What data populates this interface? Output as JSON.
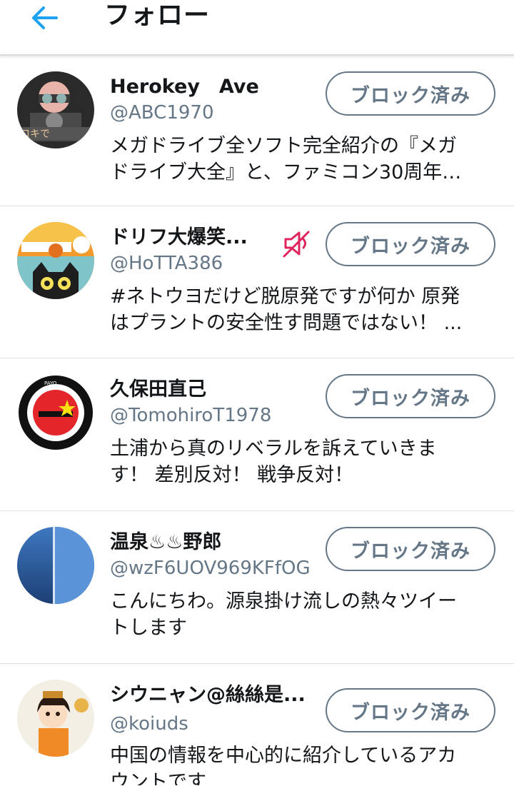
{
  "header": {
    "title": "フォロー",
    "back_icon": "arrow-left-icon",
    "accent_color": "#1da1f2"
  },
  "users": [
    {
      "name": "Herokey　Ave",
      "handle": "@ABC1970",
      "bio_line1": "メガドライブ全ソフト完全紹介の『メガ",
      "bio_line2": "ドライブ大全』と、ファミコン30周年…",
      "button": "ブロック済み",
      "muted": false
    },
    {
      "name": "ドリフ大爆笑...",
      "handle": "@HoTTA386",
      "bio_line1": "#ネトウヨだけど脱原発ですが何か 原発",
      "bio_line2": "はプラントの安全性す問題ではない！ ...",
      "button": "ブロック済み",
      "muted": true,
      "muted_icon": "mute-icon"
    },
    {
      "name": "久保田直己",
      "handle": "@TomohiroT1978",
      "bio_line1": "土浦から真のリベラルを訴えていきま",
      "bio_line2": "す！ 差別反対！ 戦争反対！",
      "button": "ブロック済み",
      "muted": false
    },
    {
      "name": "温泉♨♨野郎",
      "handle": "@wzF6UOV969KFfOG",
      "bio_line1": "こんにちわ。源泉掛け流しの熱々ツイー",
      "bio_line2": "トします",
      "button": "ブロック済み",
      "muted": false
    },
    {
      "name": "シウニャン@絲絲是...",
      "handle": "@koiuds",
      "bio_line1": "中国の情報を中心的に紹介しているアカ",
      "bio_line2": "ウントです",
      "button": "ブロック済み",
      "muted": false
    }
  ],
  "colors": {
    "secondary_text": "#657786",
    "primary_text": "#14171a",
    "mute_icon": "#e0245e"
  }
}
